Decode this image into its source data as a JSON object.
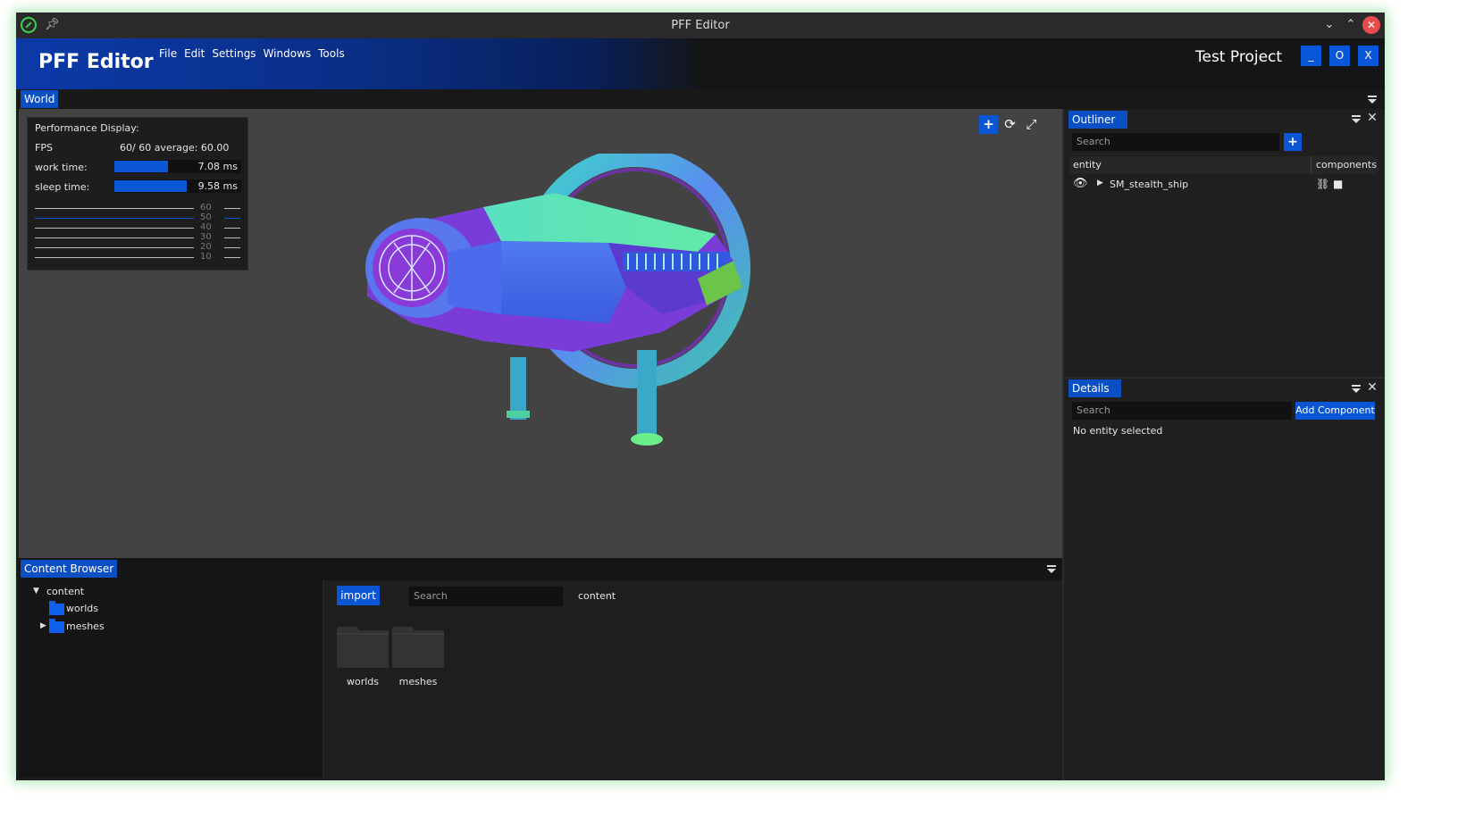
{
  "window": {
    "title": "PFF Editor"
  },
  "header": {
    "brand": "PFF Editor",
    "menu": [
      "File",
      "Edit",
      "Settings",
      "Windows",
      "Tools"
    ],
    "project": "Test Project",
    "buttons": {
      "minimize": "_",
      "maximize": "O",
      "close": "X"
    }
  },
  "world_tab": {
    "label": "World"
  },
  "perf": {
    "title": "Performance Display:",
    "fps_label": "FPS",
    "fps_value": "60/  60  average: 60.00",
    "work_label": "work time:",
    "work_value": "7.08 ms",
    "work_fraction": 0.42,
    "sleep_label": "sleep time:",
    "sleep_value": "9.58 ms",
    "sleep_fraction": 0.57,
    "graph_labels": [
      "60",
      "50",
      "40",
      "30",
      "20",
      "10"
    ]
  },
  "outliner": {
    "tab": "Outliner",
    "search_placeholder": "Search",
    "col_entity": "entity",
    "col_components": "components",
    "entities": [
      {
        "name": "SM_stealth_ship"
      }
    ]
  },
  "details": {
    "tab": "Details",
    "search_placeholder": "Search",
    "add_component": "Add Component",
    "empty_text": "No entity selected"
  },
  "content_browser": {
    "tab": "Content Browser",
    "tree_root": "content",
    "tree_children": [
      "worlds",
      "meshes"
    ],
    "import_label": "import",
    "search_placeholder": "Search",
    "path": "content",
    "folders": [
      "worlds",
      "meshes"
    ]
  },
  "colors": {
    "accent": "#0b4fc4",
    "viewport_bg": "#434343"
  },
  "icons": [
    "app-icon",
    "pin-icon",
    "eye-icon",
    "expand-arrow-icon",
    "hierarchy-icon",
    "cube-icon",
    "add-entity-icon",
    "move-tool-icon",
    "rotate-tool-icon",
    "scale-tool-icon",
    "panel-menu-icon",
    "close-icon",
    "folder-icon"
  ]
}
